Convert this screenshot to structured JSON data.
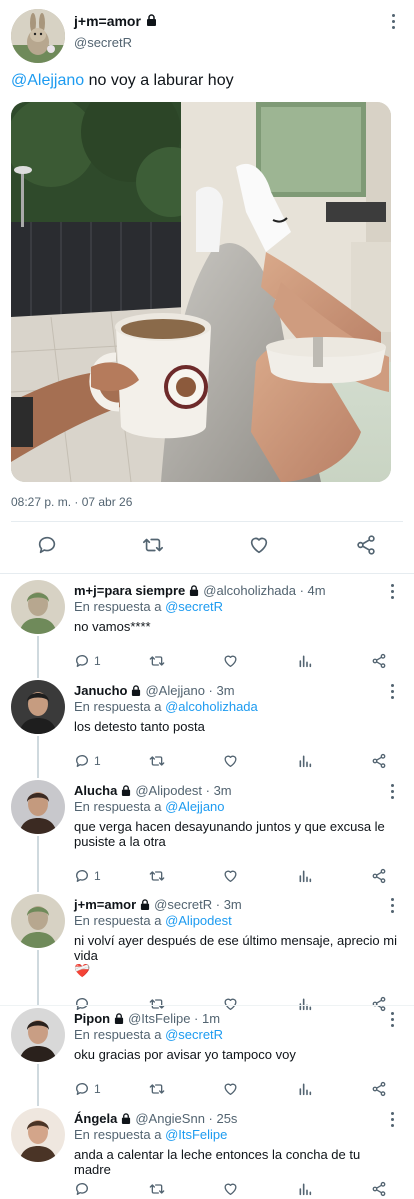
{
  "main_tweet": {
    "display_name": "j+m=amor",
    "handle": "@secretR",
    "mention": "@Alejjano",
    "text": " no voy a laburar hoy",
    "timestamp": "08:27 p. m. · 07 abr 26",
    "locked": true
  },
  "replies": [
    {
      "display_name": "m+j=para siempre",
      "meta": "@alcoholizhada · 4m",
      "in_reply_prefix": "En respuesta a ",
      "in_reply_to": "@secretR",
      "text": "no vamos****",
      "reply_count": "1"
    },
    {
      "display_name": "Janucho",
      "meta": "@Alejjano · 3m",
      "in_reply_prefix": "En respuesta a ",
      "in_reply_to": "@alcoholizhada",
      "text": "los detesto tanto posta",
      "reply_count": "1"
    },
    {
      "display_name": "Alucha",
      "meta": "@Alipodest · 3m",
      "in_reply_prefix": "En respuesta a ",
      "in_reply_to": "@Alejjano",
      "text": "que verga hacen desayunando juntos y que excusa le pusiste a la otra",
      "reply_count": "1"
    },
    {
      "display_name": "j+m=amor",
      "meta": "@secretR · 3m",
      "in_reply_prefix": "En respuesta a ",
      "in_reply_to": "@Alipodest",
      "text": "ni volví ayer después de ese último mensaje, aprecio mi vida",
      "emoji": "❤️‍🩹",
      "reply_count": ""
    },
    {
      "display_name": "Pipon",
      "meta": "@ItsFelipe · 1m",
      "in_reply_prefix": "En respuesta a ",
      "in_reply_to": "@secretR",
      "text": "oku gracias por avisar yo tampoco voy",
      "reply_count": "1"
    },
    {
      "display_name": "Ángela",
      "meta": "@AngieSnn · 25s",
      "in_reply_prefix": "En respuesta a ",
      "in_reply_to": "@ItsFelipe",
      "text": "anda a calentar la leche entonces la concha de tu madre",
      "reply_count": ""
    }
  ],
  "icons": {
    "reply": "reply-icon",
    "retweet": "retweet-icon",
    "like": "like-icon",
    "views": "views-icon",
    "share": "share-icon",
    "lock": "lock-icon",
    "more": "more-icon"
  },
  "colors": {
    "accent": "#1d9bf0",
    "secondary_text": "#536471",
    "primary_text": "#0f1419",
    "thread_line": "#cfd9de"
  }
}
